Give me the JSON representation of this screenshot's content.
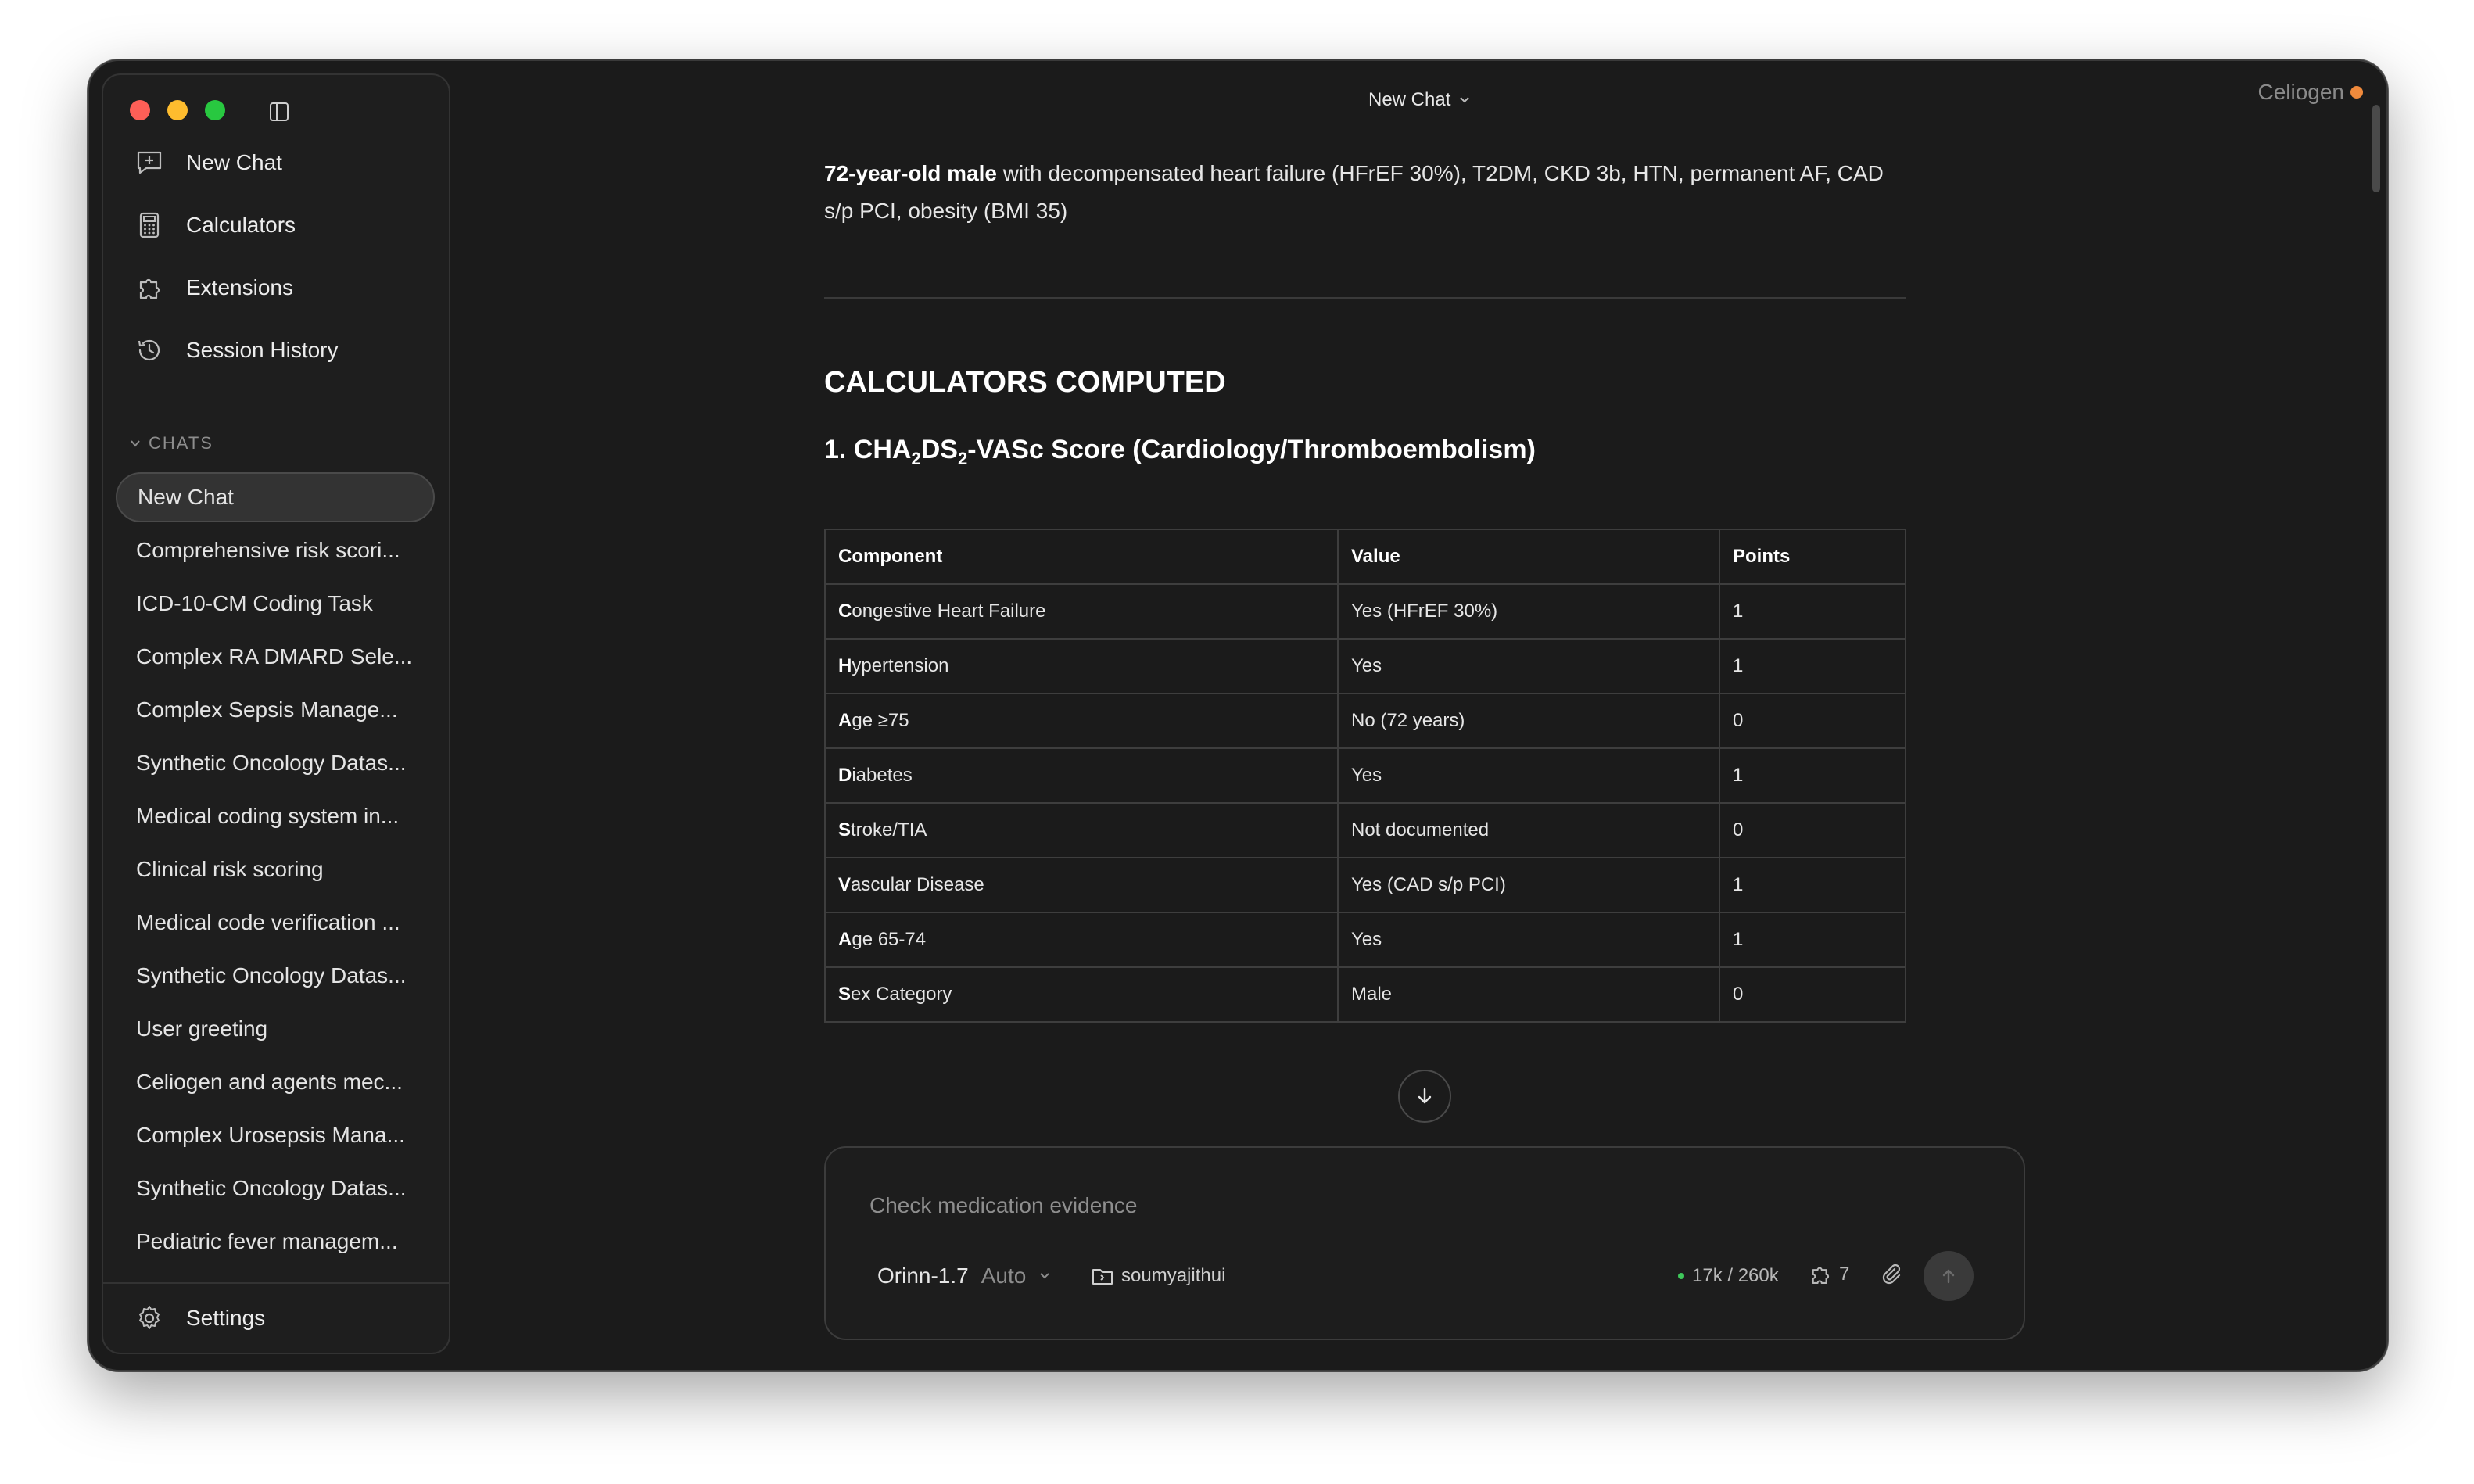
{
  "window": {
    "title": "New Chat",
    "brand": "Celiogen"
  },
  "sidebar": {
    "nav": [
      {
        "label": "New Chat",
        "icon": "new-chat-icon"
      },
      {
        "label": "Calculators",
        "icon": "calculator-icon"
      },
      {
        "label": "Extensions",
        "icon": "puzzle-icon"
      },
      {
        "label": "Session History",
        "icon": "history-icon"
      }
    ],
    "chats_header": "CHATS",
    "chats": [
      "New Chat",
      "Comprehensive risk scori...",
      "ICD-10-CM Coding Task",
      "Complex RA DMARD Sele...",
      "Complex Sepsis Manage...",
      "Synthetic Oncology Datas...",
      "Medical coding system in...",
      "Clinical risk scoring",
      "Medical code verification ...",
      "Synthetic Oncology Datas...",
      "User greeting",
      "Celiogen and agents mec...",
      "Complex Urosepsis Mana...",
      "Synthetic Oncology Datas...",
      "Pediatric fever managem..."
    ],
    "settings": "Settings"
  },
  "message": {
    "intro_bold": "72-year-old male",
    "intro_rest": " with decompensated heart failure (HFrEF 30%), T2DM, CKD 3b, HTN, permanent AF, CAD s/p PCI, obesity (BMI 35)",
    "heading": "CALCULATORS COMPUTED",
    "subheading_pre": "1. CHA",
    "subheading_sub1": "2",
    "subheading_mid": "DS",
    "subheading_sub2": "2",
    "subheading_post": "-VASc Score (Cardiology/Thromboembolism)",
    "table": {
      "headers": [
        "Component",
        "Value",
        "Points"
      ],
      "rows": [
        {
          "first": "C",
          "rest": "ongestive Heart Failure",
          "value": "Yes (HFrEF 30%)",
          "points": "1"
        },
        {
          "first": "H",
          "rest": "ypertension",
          "value": "Yes",
          "points": "1"
        },
        {
          "first": "A",
          "rest": "ge ≥75",
          "value": "No (72 years)",
          "points": "0"
        },
        {
          "first": "D",
          "rest": "iabetes",
          "value": "Yes",
          "points": "1"
        },
        {
          "first": "S",
          "rest": "troke/TIA",
          "value": "Not documented",
          "points": "0"
        },
        {
          "first": "V",
          "rest": "ascular Disease",
          "value": "Yes (CAD s/p PCI)",
          "points": "1"
        },
        {
          "first": "A",
          "rest": "ge 65-74",
          "value": "Yes",
          "points": "1"
        },
        {
          "first": "S",
          "rest": "ex Category",
          "value": "Male",
          "points": "0"
        }
      ]
    }
  },
  "composer": {
    "placeholder": "Check medication evidence",
    "model": "Orinn-1.7",
    "mode": "Auto",
    "folder": "soumyajithui",
    "tokens": "17k / 260k",
    "extensions_count": "7"
  }
}
